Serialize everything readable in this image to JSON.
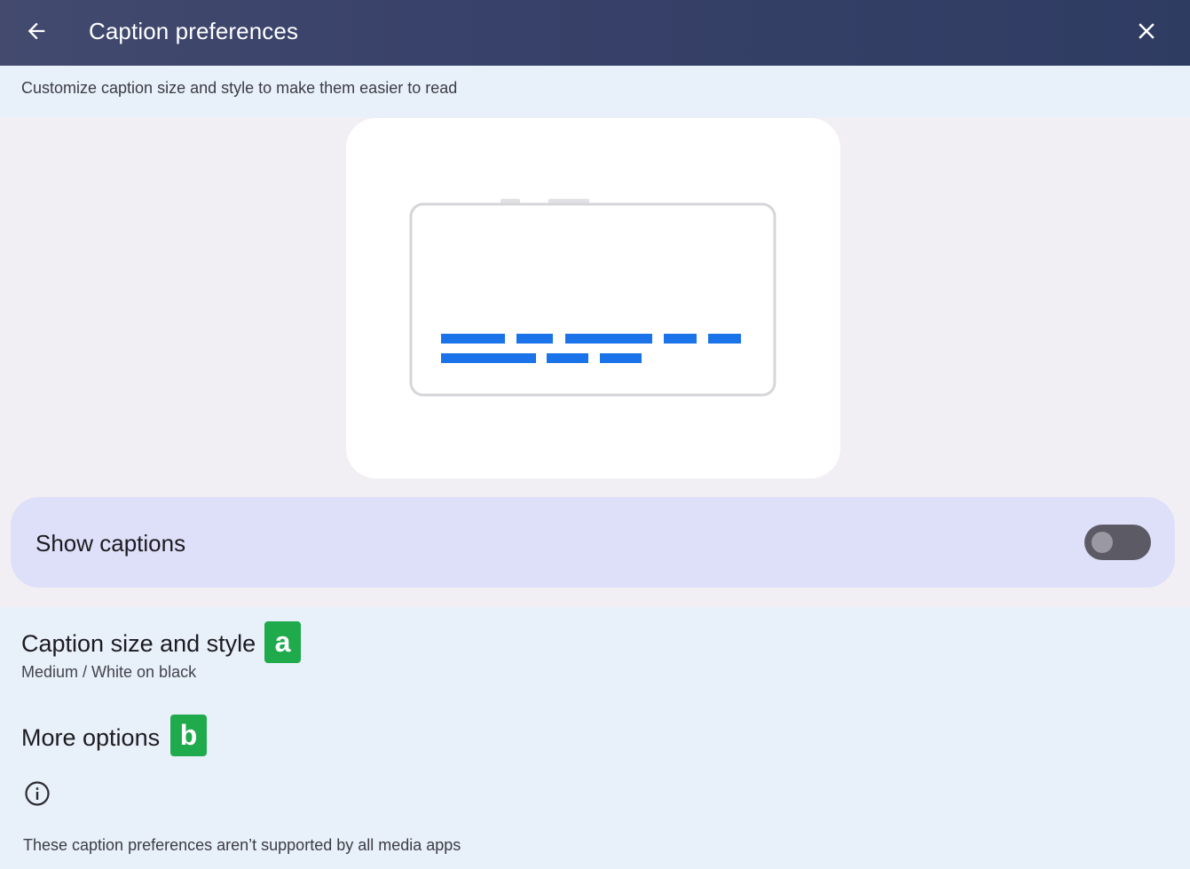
{
  "header": {
    "title": "Caption preferences",
    "back_icon": "arrow-left-icon",
    "close_icon": "close-icon"
  },
  "subtitle": "Customize caption size and style to make them easier to read",
  "preview": {
    "caption_color": "#1a73e8"
  },
  "show_captions": {
    "label": "Show captions",
    "enabled": false
  },
  "settings": [
    {
      "title": "Caption size and style",
      "summary": "Medium / White on black",
      "badge": "a"
    },
    {
      "title": "More options",
      "badge": "b"
    }
  ],
  "footer": {
    "icon": "info-icon",
    "note": "These caption preferences aren’t supported by all media apps"
  },
  "colors": {
    "header_bg": "#363f67",
    "accent_green": "#1faa4c",
    "toggle_row_bg": "#dde0f8",
    "lower_bg": "#e8f0fa"
  }
}
